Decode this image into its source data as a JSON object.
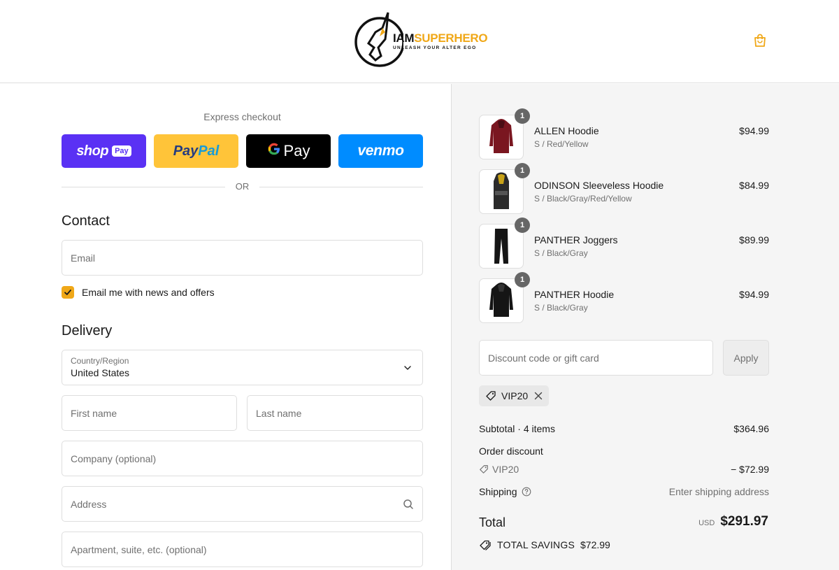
{
  "header": {
    "brand_part1": "IAM",
    "brand_part2": "SUPERHERO",
    "tagline": "UNLEASH YOUR ALTER EGO",
    "cart_icon": "shopping-bag-icon",
    "accent": "#f0a818"
  },
  "express": {
    "label": "Express checkout",
    "shop_pay_text": "shop",
    "shop_pay_pill": "Pay",
    "paypal_p1": "Pay",
    "paypal_p2": "Pal",
    "gpay_g": "G",
    "gpay_text": "Pay",
    "venmo_text": "venmo",
    "or_label": "OR"
  },
  "contact": {
    "title": "Contact",
    "email_placeholder": "Email",
    "newsletter_label": "Email me with news and offers",
    "newsletter_checked": true
  },
  "delivery": {
    "title": "Delivery",
    "country_label": "Country/Region",
    "country_value": "United States",
    "first_name_placeholder": "First name",
    "last_name_placeholder": "Last name",
    "company_placeholder": "Company (optional)",
    "address_placeholder": "Address",
    "apartment_placeholder": "Apartment, suite, etc. (optional)"
  },
  "order": {
    "items": [
      {
        "name": "ALLEN Hoodie",
        "variant": "S / Red/Yellow",
        "price": "$94.99",
        "qty": "1",
        "color": "#7a1620"
      },
      {
        "name": "ODINSON Sleeveless Hoodie",
        "variant": "S / Black/Gray/Red/Yellow",
        "price": "$84.99",
        "qty": "1",
        "color": "#2b2b2b"
      },
      {
        "name": "PANTHER Joggers",
        "variant": "S / Black/Gray",
        "price": "$89.99",
        "qty": "1",
        "color": "#151515"
      },
      {
        "name": "PANTHER Hoodie",
        "variant": "S / Black/Gray",
        "price": "$94.99",
        "qty": "1",
        "color": "#151515"
      }
    ],
    "discount_placeholder": "Discount code or gift card",
    "apply_label": "Apply",
    "applied_code": "VIP20",
    "subtotal_label": "Subtotal · 4 items",
    "subtotal_value": "$364.96",
    "order_discount_label": "Order discount",
    "discount_code": "VIP20",
    "discount_value": "− $72.99",
    "shipping_label": "Shipping",
    "shipping_value": "Enter shipping address",
    "total_label": "Total",
    "currency": "USD",
    "total_value": "$291.97",
    "savings_label": "TOTAL SAVINGS",
    "savings_value": "$72.99"
  }
}
